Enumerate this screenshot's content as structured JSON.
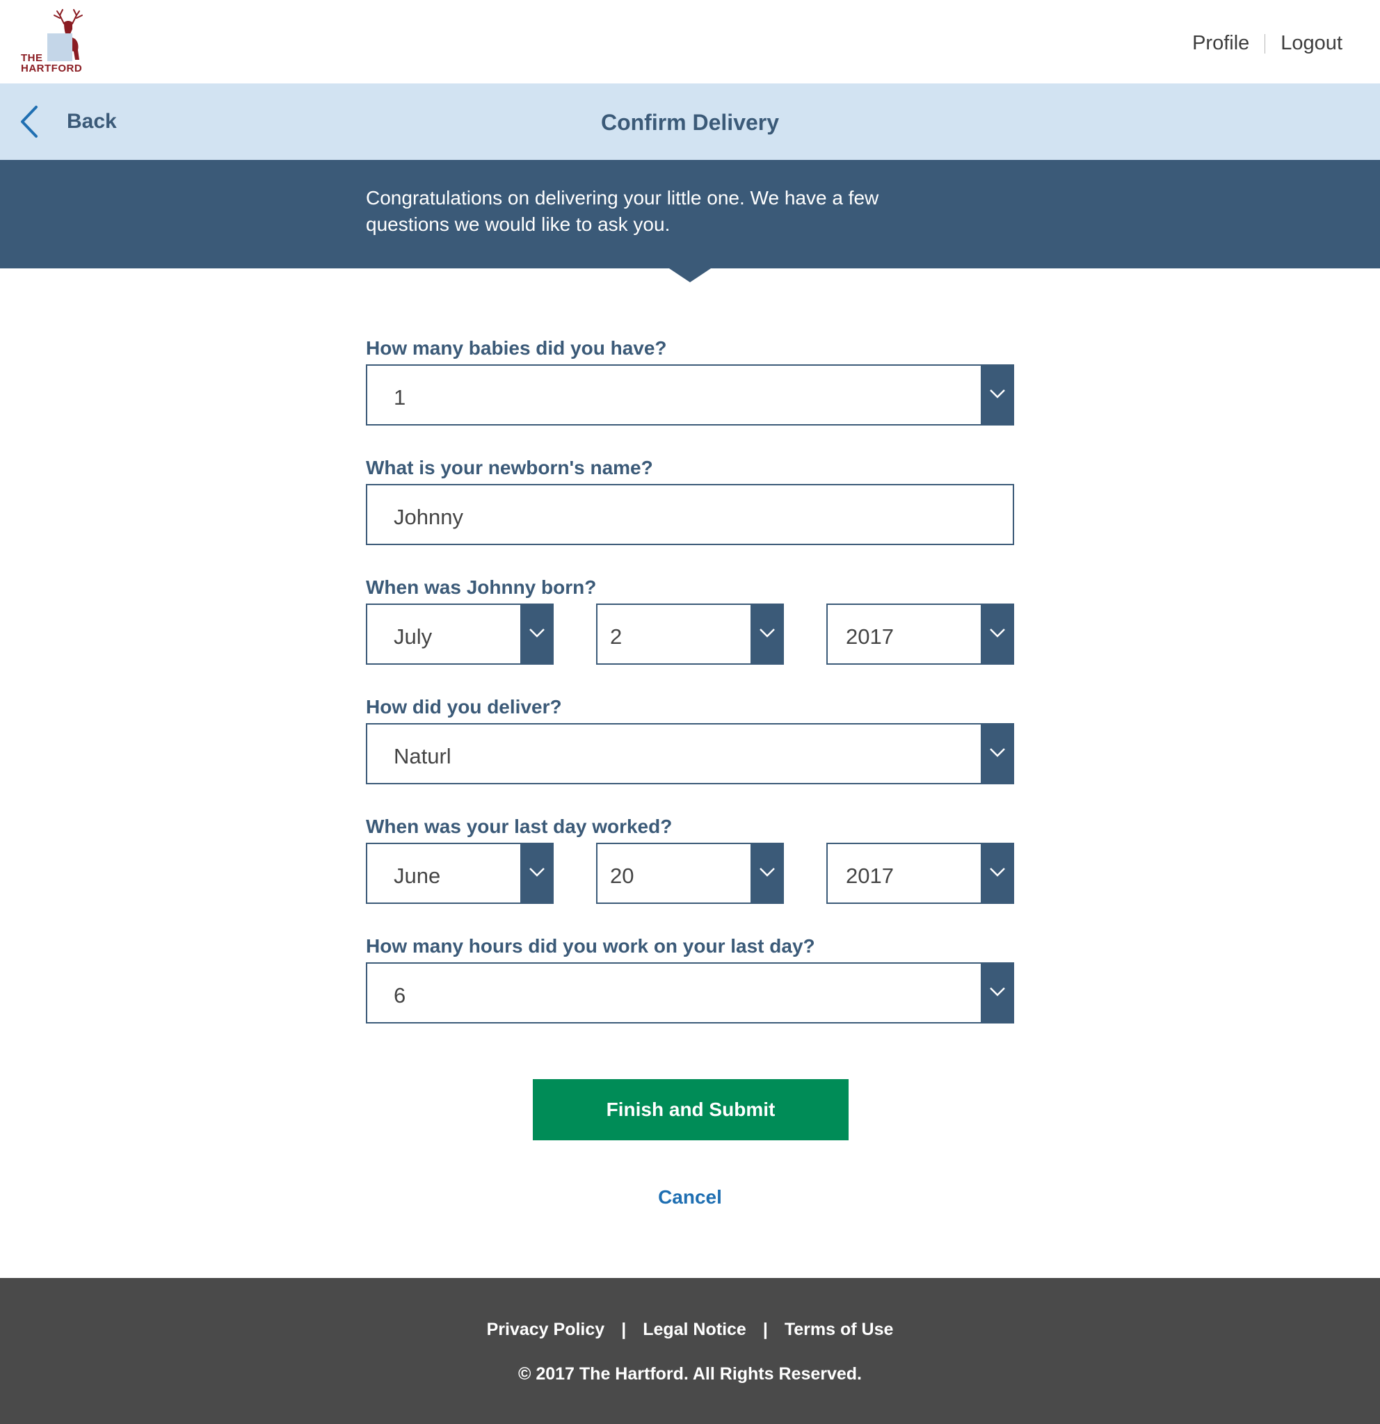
{
  "header": {
    "logo_line1": "THE",
    "logo_line2": "HARTFORD",
    "profile_label": "Profile",
    "logout_label": "Logout"
  },
  "titlebar": {
    "back_label": "Back",
    "title": "Confirm Delivery"
  },
  "intro": {
    "text": "Congratulations on delivering your little one. We have a few questions we would like to ask you."
  },
  "form": {
    "babies": {
      "label": "How many babies did you have?",
      "value": "1"
    },
    "name": {
      "label": "What is your newborn's name?",
      "value": "Johnny"
    },
    "born": {
      "label": "When was Johnny born?",
      "month": "July",
      "day": "2",
      "year": "2017"
    },
    "delivery": {
      "label": "How did you deliver?",
      "value": "Naturl"
    },
    "lastday": {
      "label": "When was your last day worked?",
      "month": "June",
      "day": "20",
      "year": "2017"
    },
    "hours": {
      "label": "How many hours did you work on your last day?",
      "value": "6"
    }
  },
  "actions": {
    "submit_label": "Finish and Submit",
    "cancel_label": "Cancel"
  },
  "footer": {
    "links": [
      "Privacy Policy",
      "Legal Notice",
      "Terms of Use"
    ],
    "separator": "|",
    "copyright": "© 2017 The Hartford. All Rights Reserved."
  },
  "colors": {
    "brand_dark_blue": "#3b5a78",
    "light_blue_bar": "#d2e3f2",
    "submit_green": "#008c57",
    "link_blue": "#1f6fb2",
    "footer_gray": "#4a4a4a",
    "logo_red": "#8a1c22"
  },
  "icons": {
    "logo": "hartford-stag-logo",
    "back": "chevron-left-icon",
    "dropdown": "chevron-down-icon"
  }
}
